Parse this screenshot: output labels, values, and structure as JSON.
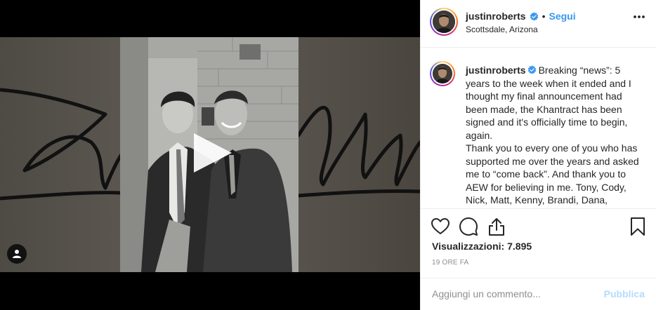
{
  "post": {
    "username": "justinroberts",
    "follow_separator": "•",
    "follow_label": "Segui",
    "location": "Scottsdale, Arizona",
    "caption_username": "justinroberts",
    "caption_text": "Breaking “news”: 5 years to the week when it ended and I thought my final announcement had been made, the Khantract has been signed and it's officially time to begin, again.\nThank you to every one of you who has supported me over the years and asked me to “come back”. And thank you to AEW for believing in me. Tony, Cody, Nick, Matt, Kenny, Brandi, Dana,",
    "views_label": "Visualizzazioni:",
    "views_count": "7.895",
    "time_ago": "19 ORE FA"
  },
  "comment": {
    "placeholder": "Aggiungi un commento...",
    "publish_label": "Pubblica"
  },
  "icons": {
    "verified": "verified-badge-icon",
    "more": "more-options-icon",
    "like": "heart-icon",
    "comment": "comment-bubble-icon",
    "share": "share-icon",
    "save": "bookmark-icon",
    "play": "play-icon",
    "user_tag": "user-tag-icon"
  },
  "colors": {
    "accent": "#3897f0",
    "verified": "#3897f0",
    "publish_disabled": "#b3dbff",
    "muted_text": "#8e8e8e",
    "border": "#efefef"
  }
}
